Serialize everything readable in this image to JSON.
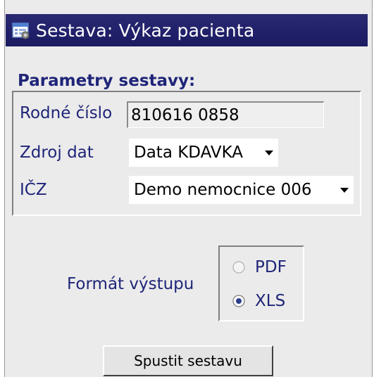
{
  "window": {
    "title": "Sestava: Výkaz pacienta",
    "icon": "report-window-icon"
  },
  "parameters": {
    "header": "Parametry sestavy:",
    "birth_number": {
      "label": "Rodné číslo",
      "value": "810616 0858"
    },
    "data_source": {
      "label": "Zdroj dat",
      "selected": "Data KDAVKA"
    },
    "icz": {
      "label": "IČZ",
      "selected": "Demo nemocnice 006"
    }
  },
  "output_format": {
    "label": "Formát výstupu",
    "options": [
      {
        "label": "PDF",
        "checked": false
      },
      {
        "label": "XLS",
        "checked": true
      }
    ]
  },
  "actions": {
    "run_label": "Spustit sestavu"
  },
  "colors": {
    "titlebar": "#20206a",
    "label_text": "#1f2578",
    "panel_background": "#ebebeb"
  }
}
